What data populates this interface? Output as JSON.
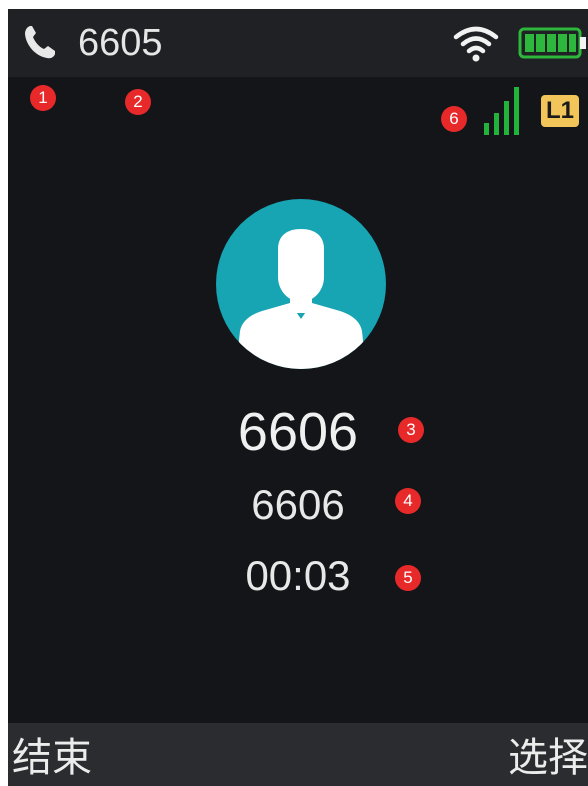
{
  "status_bar": {
    "icon": "phone-icon",
    "account_number": "6605",
    "wifi_icon": "wifi-icon",
    "battery_icon": "battery-icon",
    "battery_color": "#2db83d"
  },
  "line_status": {
    "signal_icon": "signal-icon",
    "signal_color": "#22b33a",
    "line_label": "L1",
    "line_color": "#f2c55a"
  },
  "call": {
    "avatar_icon": "avatar-icon",
    "avatar_color": "#17a4b3",
    "name": "6606",
    "number": "6606",
    "duration": "00:03"
  },
  "softkeys": {
    "left_label": "结束",
    "right_label": "选择"
  },
  "annotations": [
    "1",
    "2",
    "3",
    "4",
    "5",
    "6"
  ],
  "annotation_color": "#e8292a"
}
